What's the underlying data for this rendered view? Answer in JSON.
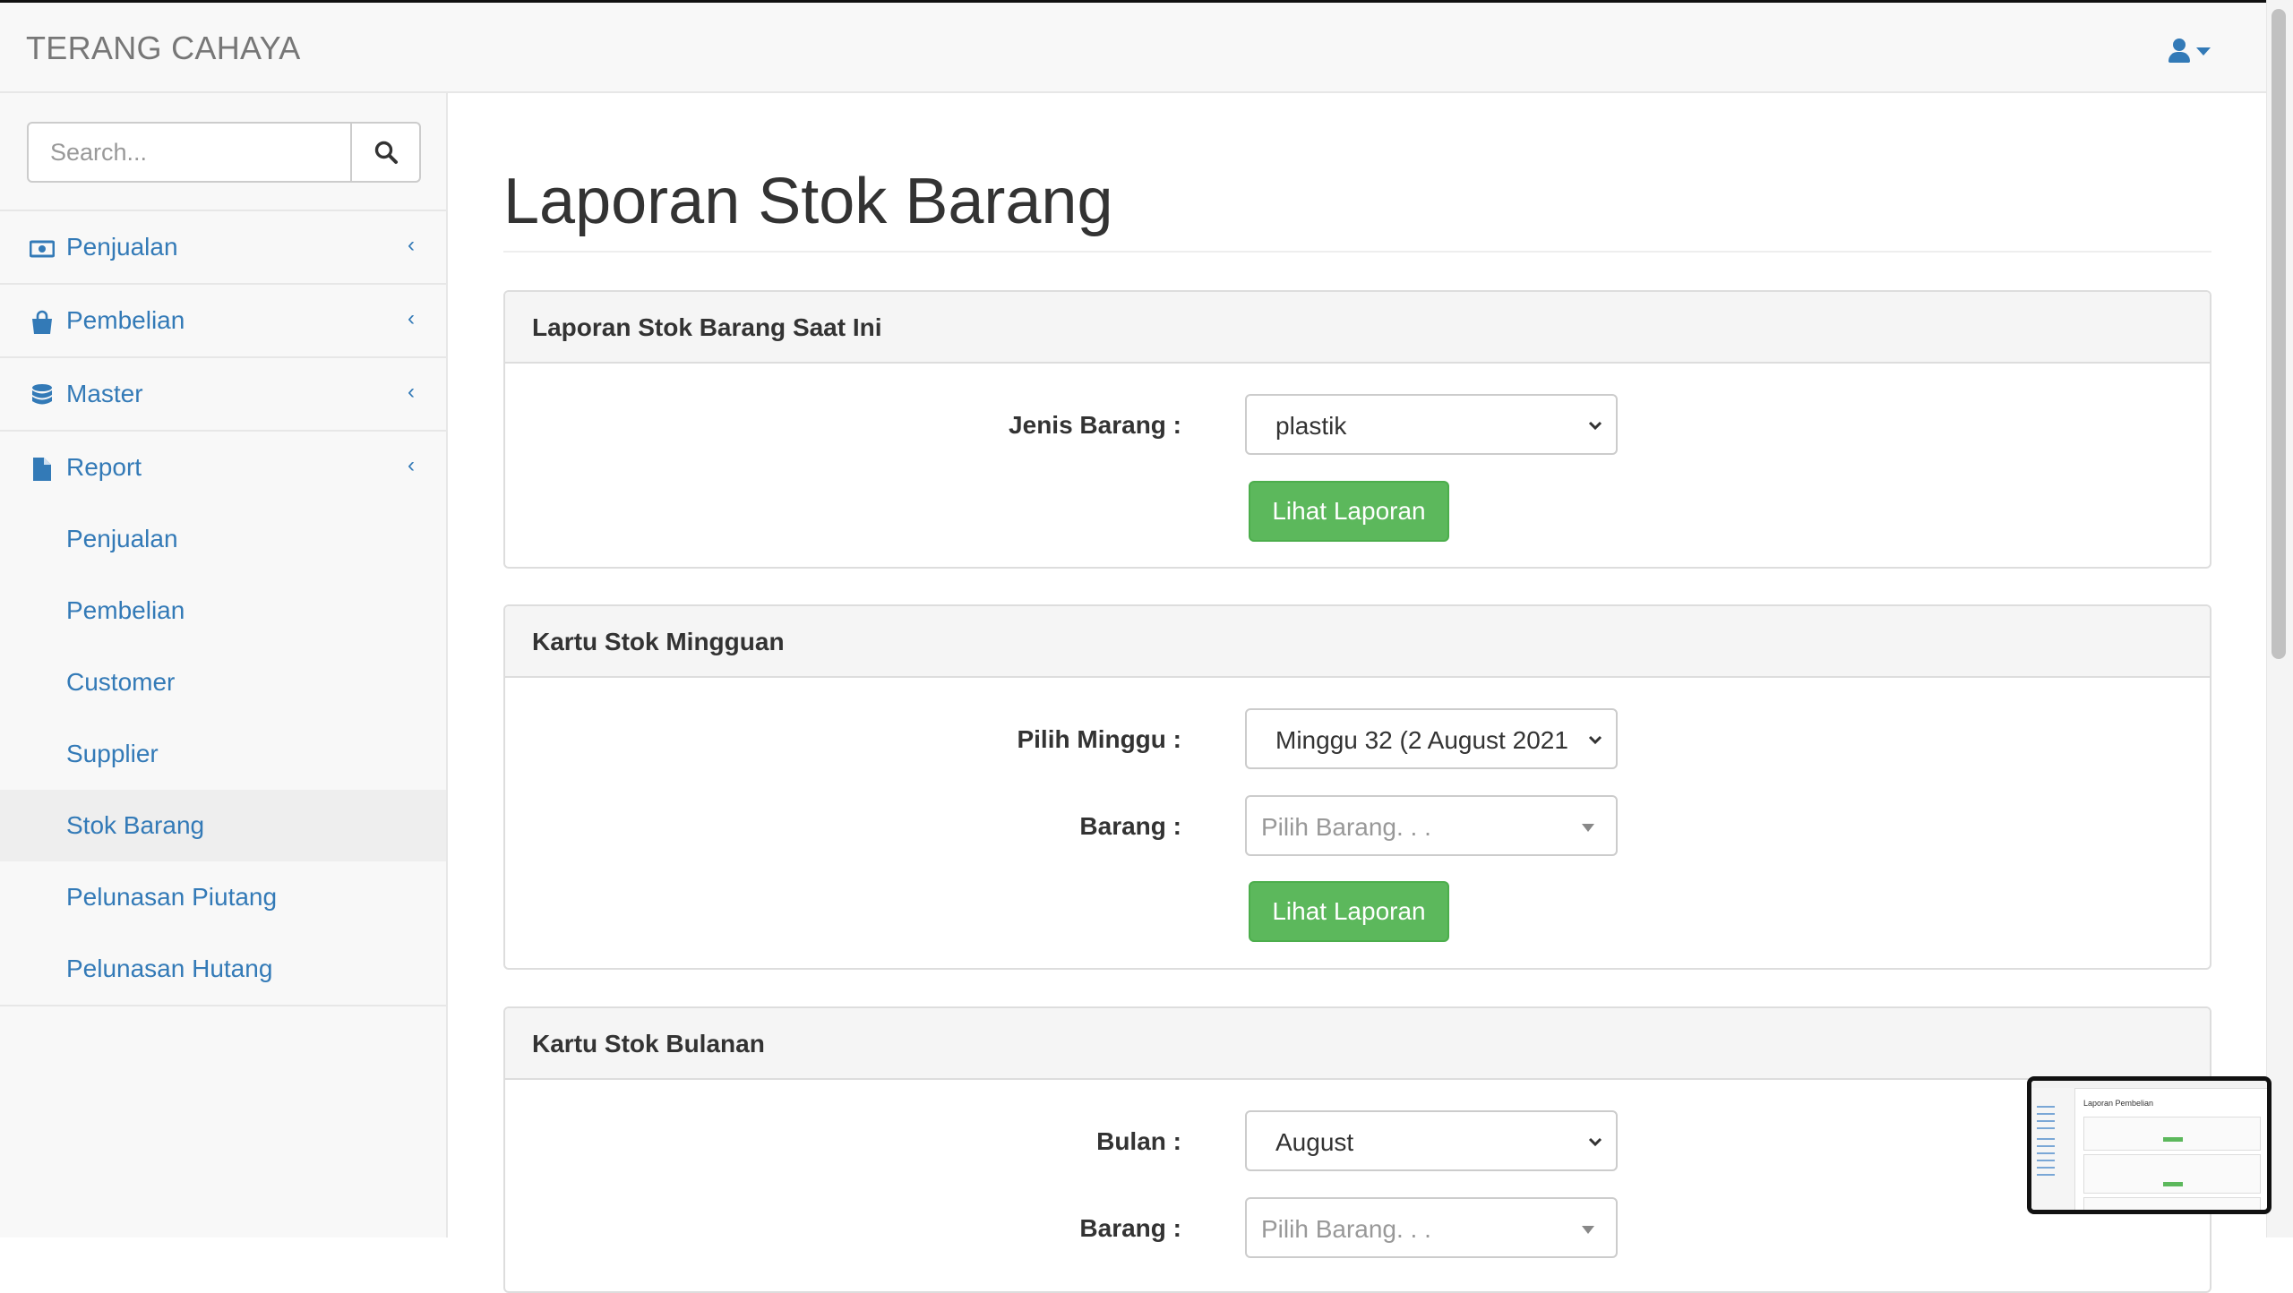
{
  "app": {
    "brand": "TERANG CAHAYA"
  },
  "search": {
    "placeholder": "Search..."
  },
  "sidebar": {
    "items": [
      {
        "label": "Penjualan",
        "icon": "money-icon"
      },
      {
        "label": "Pembelian",
        "icon": "shopping-bag-icon"
      },
      {
        "label": "Master",
        "icon": "database-icon"
      },
      {
        "label": "Report",
        "icon": "file-icon"
      }
    ],
    "chevron": "‹",
    "report_subitems": [
      {
        "label": "Penjualan"
      },
      {
        "label": "Pembelian"
      },
      {
        "label": "Customer"
      },
      {
        "label": "Supplier"
      },
      {
        "label": "Stok Barang",
        "active": true
      },
      {
        "label": "Pelunasan Piutang"
      },
      {
        "label": "Pelunasan Hutang"
      }
    ]
  },
  "page": {
    "title": "Laporan Stok Barang"
  },
  "panels": [
    {
      "heading": "Laporan Stok Barang Saat Ini",
      "fields": [
        {
          "label": "Jenis Barang :",
          "value": "plastik",
          "kind": "select"
        }
      ],
      "button": "Lihat Laporan"
    },
    {
      "heading": "Kartu Stok Mingguan",
      "fields": [
        {
          "label": "Pilih Minggu :",
          "value": "Minggu 32 (2 August 2021",
          "kind": "select"
        },
        {
          "label": "Barang :",
          "value": "Pilih Barang. . .",
          "kind": "select2"
        }
      ],
      "button": "Lihat Laporan"
    },
    {
      "heading": "Kartu Stok Bulanan",
      "fields": [
        {
          "label": "Bulan :",
          "value": "August",
          "kind": "select"
        },
        {
          "label": "Barang :",
          "value": "Pilih Barang. . .",
          "kind": "select2"
        }
      ]
    }
  ],
  "thumbnail": {
    "title": "Laporan Pembelian"
  },
  "colors": {
    "link": "#337ab7",
    "success": "#5cb85c",
    "panel_heading": "#f5f5f5"
  }
}
